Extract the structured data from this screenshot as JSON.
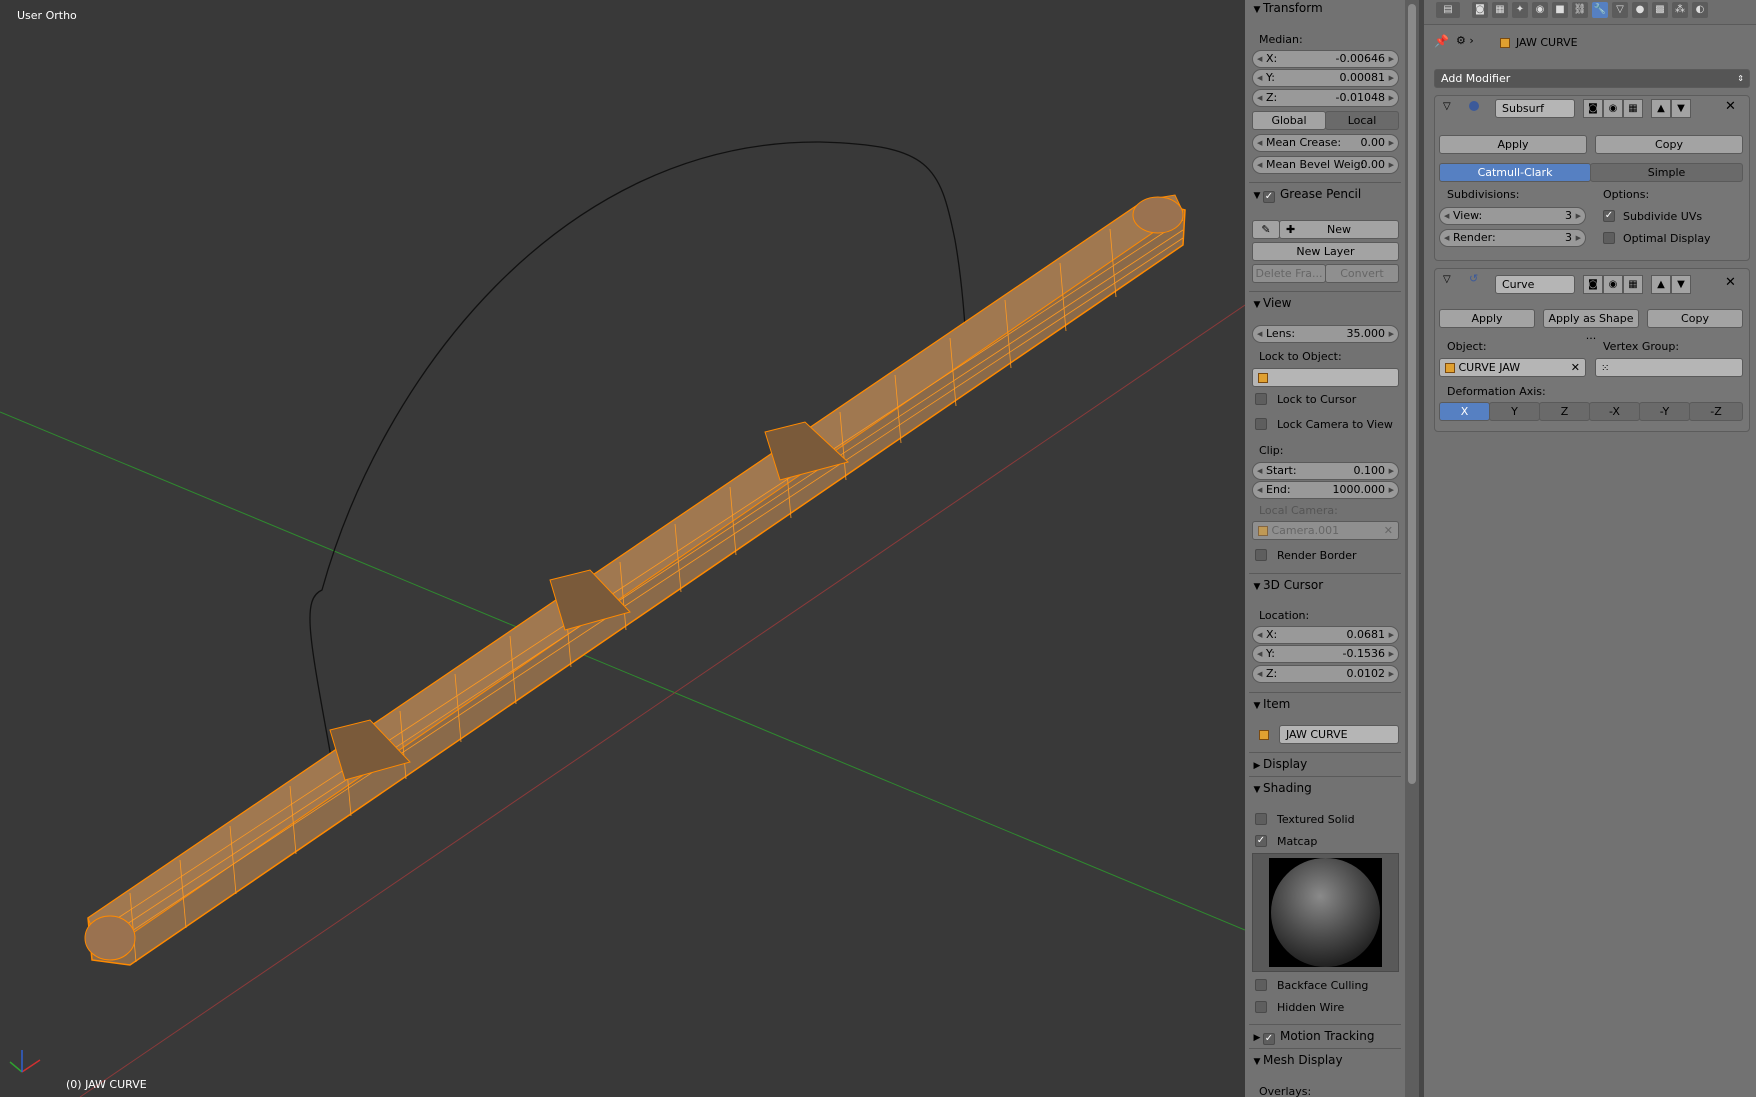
{
  "viewport": {
    "view_name": "User Ortho",
    "object_status": "(0) JAW CURVE"
  },
  "npanel": {
    "transform": {
      "header": "Transform",
      "median_label": "Median:",
      "x": {
        "key": "X:",
        "value": "-0.00646"
      },
      "y": {
        "key": "Y:",
        "value": "0.00081"
      },
      "z": {
        "key": "Z:",
        "value": "-0.01048"
      },
      "global_label": "Global",
      "local_label": "Local",
      "mean_crease": {
        "key": "Mean Crease:",
        "value": "0.00"
      },
      "mean_bevel": {
        "key": "Mean Bevel Weig:",
        "value": "0.00"
      }
    },
    "grease_pencil": {
      "header": "Grease Pencil",
      "new_label": "New",
      "new_layer_label": "New Layer",
      "delete_frame_label": "Delete Fra...",
      "convert_label": "Convert"
    },
    "view": {
      "header": "View",
      "lens": {
        "key": "Lens:",
        "value": "35.000"
      },
      "lock_to_object_label": "Lock to Object:",
      "lock_to_cursor": "Lock to Cursor",
      "lock_camera_to_view": "Lock Camera to View",
      "clip_label": "Clip:",
      "clip_start": {
        "key": "Start:",
        "value": "0.100"
      },
      "clip_end": {
        "key": "End:",
        "value": "1000.000"
      },
      "local_camera_label": "Local Camera:",
      "local_camera_value": "Camera.001",
      "render_border": "Render Border"
    },
    "cursor": {
      "header": "3D Cursor",
      "location_label": "Location:",
      "x": {
        "key": "X:",
        "value": "0.0681"
      },
      "y": {
        "key": "Y:",
        "value": "-0.1536"
      },
      "z": {
        "key": "Z:",
        "value": "0.0102"
      }
    },
    "item": {
      "header": "Item",
      "name": "JAW CURVE"
    },
    "display": {
      "header": "Display"
    },
    "shading": {
      "header": "Shading",
      "textured_solid": "Textured Solid",
      "matcap": "Matcap",
      "backface_culling": "Backface Culling",
      "hidden_wire": "Hidden Wire"
    },
    "motion_tracking": {
      "header": "Motion Tracking"
    },
    "mesh_display": {
      "header": "Mesh Display",
      "overlays_label": "Overlays:"
    }
  },
  "properties": {
    "breadcrumb_object": "JAW CURVE",
    "add_modifier_label": "Add Modifier",
    "subsurf": {
      "name": "Subsurf",
      "apply_label": "Apply",
      "copy_label": "Copy",
      "catmull_clark_label": "Catmull-Clark",
      "simple_label": "Simple",
      "subdivisions_label": "Subdivisions:",
      "options_label": "Options:",
      "view": {
        "key": "View:",
        "value": "3"
      },
      "render": {
        "key": "Render:",
        "value": "3"
      },
      "subdivide_uvs": "Subdivide UVs",
      "optimal_display": "Optimal Display"
    },
    "curve": {
      "name": "Curve",
      "apply_label": "Apply",
      "apply_as_shape_label": "Apply as Shape ...",
      "copy_label": "Copy",
      "object_label": "Object:",
      "vertex_group_label": "Vertex Group:",
      "object_value": "CURVE JAW",
      "deformation_axis_label": "Deformation Axis:",
      "axes": [
        "X",
        "Y",
        "Z",
        "-X",
        "-Y",
        "-Z"
      ]
    }
  },
  "colors": {
    "viewport_bg": "#393939",
    "mesh_orange": "#ff8a00",
    "selection_blue": "#5680c2",
    "panel_bg": "#727272"
  }
}
